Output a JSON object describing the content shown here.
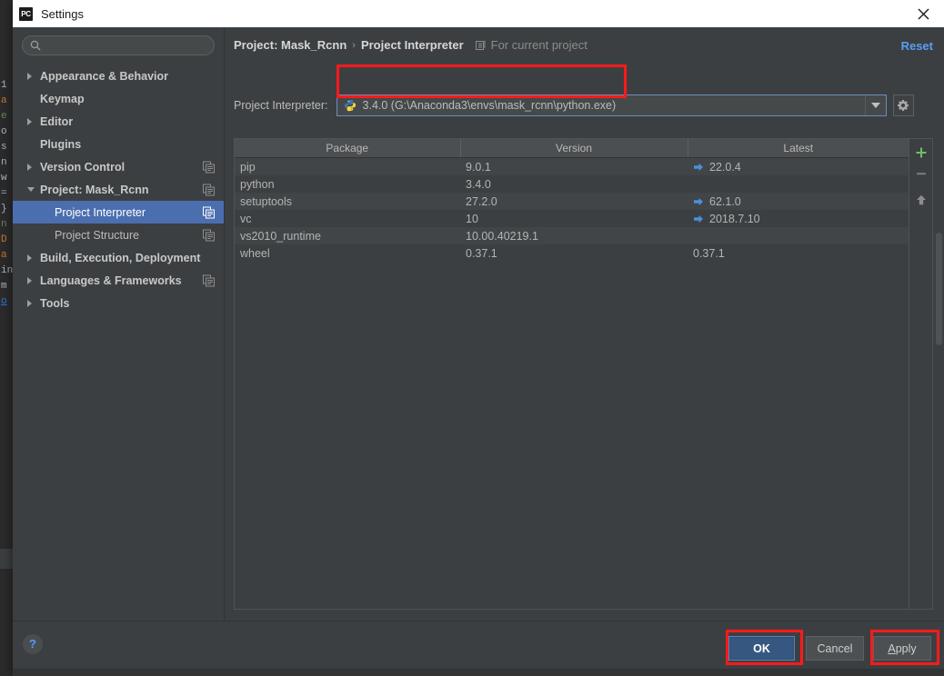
{
  "window": {
    "title": "Settings",
    "app_icon": "PC",
    "close_icon": "close-icon"
  },
  "sidebar": {
    "search": {
      "value": "",
      "placeholder": "",
      "icon": "search-icon"
    },
    "items": [
      {
        "label": "Appearance & Behavior",
        "arrow": "right",
        "bold": true,
        "child": false,
        "selected": false,
        "config_icon": false
      },
      {
        "label": "Keymap",
        "arrow": "none",
        "bold": true,
        "child": false,
        "selected": false,
        "config_icon": false
      },
      {
        "label": "Editor",
        "arrow": "right",
        "bold": true,
        "child": false,
        "selected": false,
        "config_icon": false
      },
      {
        "label": "Plugins",
        "arrow": "none",
        "bold": true,
        "child": false,
        "selected": false,
        "config_icon": false
      },
      {
        "label": "Version Control",
        "arrow": "right",
        "bold": true,
        "child": false,
        "selected": false,
        "config_icon": true
      },
      {
        "label": "Project: Mask_Rcnn",
        "arrow": "down",
        "bold": true,
        "child": false,
        "selected": false,
        "config_icon": true
      },
      {
        "label": "Project Interpreter",
        "arrow": "none",
        "bold": false,
        "child": true,
        "selected": true,
        "config_icon": true
      },
      {
        "label": "Project Structure",
        "arrow": "none",
        "bold": false,
        "child": true,
        "selected": false,
        "config_icon": true
      },
      {
        "label": "Build, Execution, Deployment",
        "arrow": "right",
        "bold": true,
        "child": false,
        "selected": false,
        "config_icon": false
      },
      {
        "label": "Languages & Frameworks",
        "arrow": "right",
        "bold": true,
        "child": false,
        "selected": false,
        "config_icon": true
      },
      {
        "label": "Tools",
        "arrow": "right",
        "bold": true,
        "child": false,
        "selected": false,
        "config_icon": false
      }
    ]
  },
  "main": {
    "breadcrumb": {
      "parent": "Project: Mask_Rcnn",
      "separator": "›",
      "current": "Project Interpreter",
      "scope_icon": "scope-icon",
      "scope_text": "For current project"
    },
    "reset_label": "Reset",
    "interpreter": {
      "label": "Project Interpreter:",
      "icon": "python-icon",
      "value": "3.4.0 (G:\\Anaconda3\\envs\\mask_rcnn\\python.exe)",
      "dropdown_icon": "chevron-down-icon",
      "gear_icon": "gear-icon"
    },
    "packages": {
      "columns": [
        "Package",
        "Version",
        "Latest"
      ],
      "rows": [
        {
          "package": "pip",
          "version": "9.0.1",
          "latest": "22.0.4",
          "upgradable": true
        },
        {
          "package": "python",
          "version": "3.4.0",
          "latest": "",
          "upgradable": false
        },
        {
          "package": "setuptools",
          "version": "27.2.0",
          "latest": "62.1.0",
          "upgradable": true
        },
        {
          "package": "vc",
          "version": "10",
          "latest": "2018.7.10",
          "upgradable": true
        },
        {
          "package": "vs2010_runtime",
          "version": "10.00.40219.1",
          "latest": "",
          "upgradable": false
        },
        {
          "package": "wheel",
          "version": "0.37.1",
          "latest": "0.37.1",
          "upgradable": false
        }
      ],
      "toolbar": [
        {
          "name": "add-package-button",
          "icon": "plus-icon",
          "color": "#6cc06c"
        },
        {
          "name": "remove-package-button",
          "icon": "minus-icon",
          "color": "#808080"
        },
        {
          "name": "upgrade-package-button",
          "icon": "up-arrow-icon",
          "color": "#8c8c8c"
        }
      ]
    }
  },
  "footer": {
    "help_label": "?",
    "ok_label": "OK",
    "cancel_label": "Cancel",
    "apply_accel": "A",
    "apply_rest": "pply"
  },
  "colors": {
    "dialog_bg": "#3c3f41",
    "selection_blue": "#4b6eaf",
    "accent_link": "#589df6",
    "annotation_red": "#ff1a1a",
    "upgrade_arrow_blue": "#4a90d9",
    "ok_button_blue": "#365880",
    "add_green": "#6cc06c"
  },
  "background_code": {
    "lines": [
      "1",
      "a",
      "e",
      "o",
      "s",
      "n",
      "w",
      "=",
      "}",
      "no",
      "D",
      "a",
      "in",
      "m",
      "o"
    ]
  }
}
